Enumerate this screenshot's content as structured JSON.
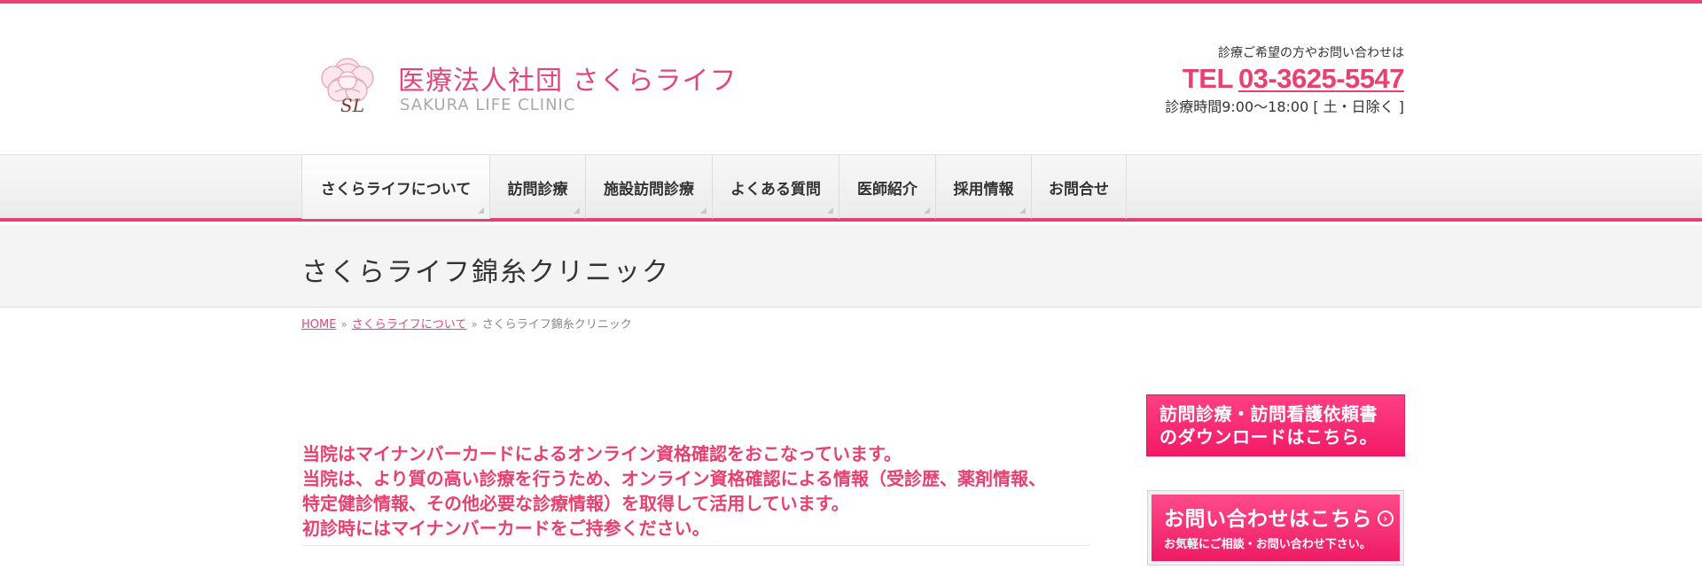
{
  "header": {
    "brand_jp": "医療法人社団 さくらライフ",
    "brand_en": "SAKURA LIFE CLINIC",
    "logo_icon": "sakura-flower-logo-icon",
    "logo_monogram": "SL"
  },
  "contact": {
    "lead": "診療ご希望の方やお問い合わせは",
    "tel_prefix": "TEL",
    "tel_number": "03-3625-5547",
    "hours": "診療時間9:00〜18:00 [ 土・日除く ]"
  },
  "nav": {
    "items": [
      {
        "label": "さくらライフについて"
      },
      {
        "label": "訪問診療"
      },
      {
        "label": "施設訪問診療"
      },
      {
        "label": "よくある質問"
      },
      {
        "label": "医師紹介"
      },
      {
        "label": "採用情報"
      },
      {
        "label": "お問合せ"
      }
    ]
  },
  "page": {
    "title": "さくらライフ錦糸クリニック"
  },
  "breadcrumb": {
    "home": "HOME",
    "parent": "さくらライフについて",
    "current": "さくらライフ錦糸クリニック",
    "separator": "»"
  },
  "notice": {
    "lines": [
      "当院はマイナンバーカードによるオンライン資格確認をおこなっています。",
      "当院は、より質の高い診療を行うため、オンライン資格確認による情報（受診歴、薬剤情報、",
      "特定健診情報、その他必要な診療情報）を取得して活用しています。",
      "初診時にはマイナンバーカードをご持参ください。"
    ]
  },
  "sidebar": {
    "banner_download": {
      "line1": "訪問診療・訪問看護依頼書",
      "line2": "のダウンロードはこちら。"
    },
    "banner_contact": {
      "main": "お問い合わせはこちら",
      "arrow": "›",
      "sub": "お気軽にご相談・お問い合わせ下さい。"
    }
  },
  "colors": {
    "accent": "#e8406f",
    "brand_text": "#e2467d",
    "banner": "#f21a66"
  }
}
